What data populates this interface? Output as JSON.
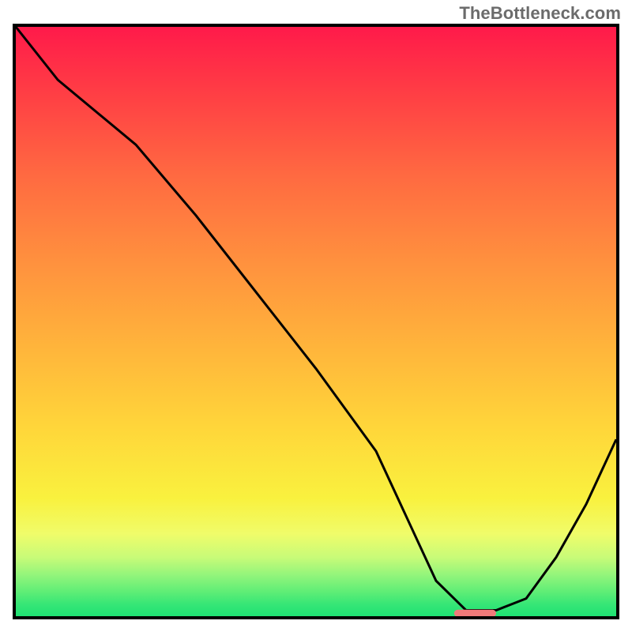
{
  "watermark": "TheBottleneck.com",
  "chart_data": {
    "type": "line",
    "title": "",
    "xlabel": "",
    "ylabel": "",
    "xlim": [
      0,
      100
    ],
    "ylim": [
      0,
      100
    ],
    "background_scheme": "red-yellow-green vertical gradient (bottleneck severity)",
    "series": [
      {
        "name": "bottleneck-curve",
        "x": [
          0,
          7,
          20,
          30,
          40,
          50,
          60,
          65,
          70,
          75,
          80,
          85,
          90,
          95,
          100
        ],
        "values": [
          100,
          91,
          80,
          68,
          55,
          42,
          28,
          17,
          6,
          1,
          1,
          3,
          10,
          19,
          30
        ]
      }
    ],
    "optimal_marker": {
      "name": "optimal-range",
      "x_start": 73,
      "x_end": 80,
      "y": 0.5,
      "color": "#f07a7a"
    }
  }
}
